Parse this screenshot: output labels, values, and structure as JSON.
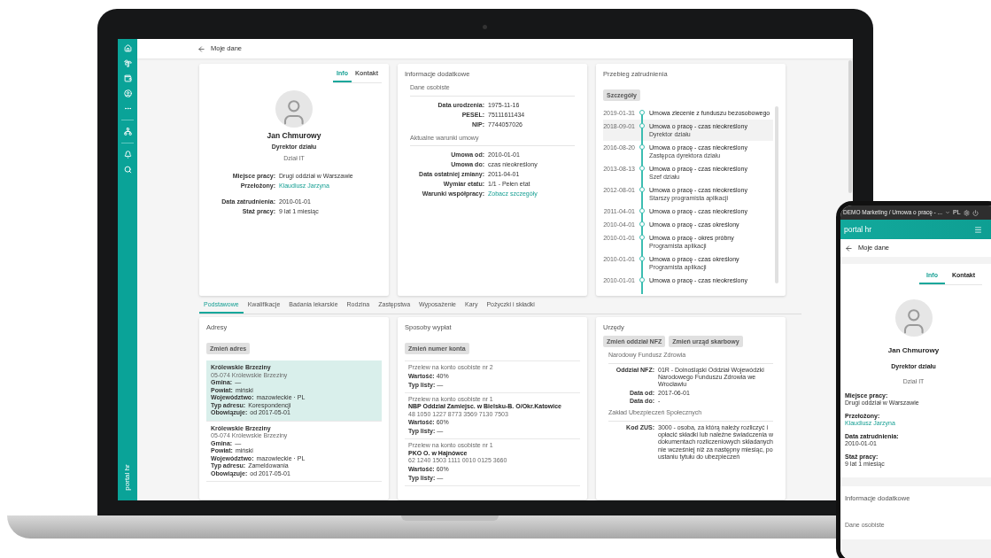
{
  "laptop": {
    "sidebar": {
      "brand": "portal hr"
    },
    "header": {
      "title": "Moje dane"
    },
    "profile_card": {
      "tabs": [
        {
          "label": "Info",
          "selected": true
        },
        {
          "label": "Kontakt",
          "selected": false
        }
      ],
      "name": "Jan Chmurowy",
      "position": "Dyrektor działu",
      "department": "Dział IT",
      "field_groups": [
        [
          {
            "label": "Miejsce pracy:",
            "value": "Drugi oddział w Warszawie",
            "kind": "text"
          },
          {
            "label": "Przełożony:",
            "value": "Klaudiusz Jarzyna",
            "kind": "link"
          }
        ],
        [
          {
            "label": "Data zatrudnienia:",
            "value": "2010-01-01",
            "kind": "text"
          },
          {
            "label": "Staż pracy:",
            "value": "9 lat 1 miesiąc",
            "kind": "text"
          }
        ]
      ]
    },
    "additional_info": {
      "title": "Informacje dodatkowe",
      "sections": [
        {
          "heading": "Dane osobiste",
          "fields": [
            {
              "label": "Data urodzenia:",
              "value": "1975-11-16",
              "kind": "text"
            },
            {
              "label": "PESEL:",
              "value": "75111611434",
              "kind": "text"
            },
            {
              "label": "NIP:",
              "value": "7744057026",
              "kind": "text"
            }
          ]
        },
        {
          "heading": "Aktualne warunki umowy",
          "fields": [
            {
              "label": "Umowa od:",
              "value": "2010-01-01",
              "kind": "text"
            },
            {
              "label": "Umowa do:",
              "value": "czas nieokreślony",
              "kind": "text"
            },
            {
              "label": "Data ostatniej zmiany:",
              "value": "2011-04-01",
              "kind": "text"
            },
            {
              "label": "Wymiar etatu:",
              "value": "1/1 - Pełen etat",
              "kind": "text"
            },
            {
              "label": "Warunki współpracy:",
              "value": "Zobacz szczegóły",
              "kind": "link"
            }
          ]
        }
      ]
    },
    "employment_history": {
      "title": "Przebieg zatrudnienia",
      "button": "Szczegóły",
      "entries": [
        {
          "date": "2019-01-31",
          "title": "Umowa zlecenie z funduszu bezosobowego",
          "selected": false
        },
        {
          "date": "2018-09-01",
          "title": "Umowa o pracę - czas nieokreślony",
          "subtitle": "Dyrektor działu",
          "selected": true
        },
        {
          "date": "2016-08-20",
          "title": "Umowa o pracę - czas nieokreślony",
          "subtitle": "Zastępca dyrektora działu",
          "selected": false
        },
        {
          "date": "2013-08-13",
          "title": "Umowa o pracę - czas nieokreślony",
          "subtitle": "Szef działu",
          "selected": false
        },
        {
          "date": "2012-08-01",
          "title": "Umowa o pracę - czas nieokreślony",
          "subtitle": "Starszy programista aplikacji",
          "selected": false
        },
        {
          "date": "2011-04-01",
          "title": "Umowa o pracę - czas nieokreślony",
          "selected": false
        },
        {
          "date": "2010-04-01",
          "title": "Umowa o pracę - czas określony",
          "selected": false
        },
        {
          "date": "2010-01-01",
          "title": "Umowa o pracę - okres próbny",
          "subtitle": "Programista aplikacji",
          "selected": false
        },
        {
          "date": "2010-01-01",
          "title": "Umowa o pracę - czas określony",
          "subtitle": "Programista aplikacji",
          "selected": false
        },
        {
          "date": "2010-01-01",
          "title": "Umowa o pracę - czas nieokreślony",
          "selected": false
        }
      ]
    },
    "tabs": [
      {
        "label": "Podstawowe",
        "selected": true
      },
      {
        "label": "Kwalifikacje",
        "selected": false
      },
      {
        "label": "Badania lekarskie",
        "selected": false
      },
      {
        "label": "Rodzina",
        "selected": false
      },
      {
        "label": "Zastępstwa",
        "selected": false
      },
      {
        "label": "Wyposażenie",
        "selected": false
      },
      {
        "label": "Kary",
        "selected": false
      },
      {
        "label": "Pożyczki i składki",
        "selected": false
      }
    ],
    "addresses": {
      "title": "Adresy",
      "button": "Zmień adres",
      "items": [
        {
          "name": "Królewskie Brzeziny",
          "postal": "05-074 Królewskie Brzeziny",
          "selected": true,
          "fields": [
            {
              "label": "Gmina:",
              "value": "—"
            },
            {
              "label": "Powiat:",
              "value": "miński"
            },
            {
              "label": "Województwo:",
              "value": "mazowieckie · PL"
            },
            {
              "label": "Typ adresu:",
              "value": "Korespondencji"
            },
            {
              "label": "Obowiązuje:",
              "value": "od 2017-05-01"
            }
          ]
        },
        {
          "name": "Królewskie Brzeziny",
          "postal": "05-074 Królewskie Brzeziny",
          "selected": false,
          "fields": [
            {
              "label": "Gmina:",
              "value": "—"
            },
            {
              "label": "Powiat:",
              "value": "miński"
            },
            {
              "label": "Województwo:",
              "value": "mazowieckie · PL"
            },
            {
              "label": "Typ adresu:",
              "value": "Zameldowania"
            },
            {
              "label": "Obowiązuje:",
              "value": "od 2017-05-01"
            }
          ]
        }
      ]
    },
    "payments": {
      "title": "Sposoby wypłat",
      "button": "Zmień numer konta",
      "items": [
        {
          "type": "Przelew na konto osobiste nr 2",
          "details": [
            "**Wartość:** 40%",
            "**Typ listy:** —"
          ]
        },
        {
          "type": "Przelew na konto osobiste nr 1",
          "bank": "NBP Oddział Zamiejsc. w Bielsku-B. O/Okr.Katowice",
          "account": "48 1050 1227 8773 3569 7130 7503",
          "details": [
            "**Wartość:** 60%",
            "**Typ listy:** —"
          ]
        },
        {
          "type": "Przelew na konto osobiste nr 1",
          "bank": "PKO O. w Hajnówce",
          "account": "62 1240 1503 1111 0010 0125 3660",
          "details": [
            "**Wartość:** 60%",
            "**Typ listy:** —"
          ]
        }
      ]
    },
    "offices": {
      "title": "Urzędy",
      "buttons": [
        "Zmień oddział NFZ",
        "Zmień urząd skarbowy"
      ],
      "sections": [
        {
          "heading": "Narodowy Fundusz Zdrowia",
          "fields": [
            {
              "label": "Oddział NFZ:",
              "value": "01R - Dolnośląski Oddział Wojewódzki Narodowego Funduszu Zdrowia we Wrocławiu"
            },
            {
              "label": "Data od:",
              "value": "2017-06-01"
            },
            {
              "label": "Data do:",
              "value": "-"
            }
          ]
        },
        {
          "heading": "Zakład Ubezpieczeń Społecznych",
          "fields": [
            {
              "label": "Kod ZUS:",
              "value": "3000 - osoba, za którą należy rozliczyć i opłacić składki lub należne świadczenia w dokumentach rozliczeniowych składanych nie wcześniej niż za następny miesiąc, po ustaniu tytułu do ubezpieczeń"
            }
          ]
        }
      ]
    }
  },
  "phone": {
    "status_bar": {
      "breadcrumb": "DEMO Marketing / Umowa o pracę - ...",
      "language": "PL"
    },
    "app_bar": {
      "title": "portal hr"
    },
    "header": {
      "title": "Moje dane"
    },
    "tabs": [
      {
        "label": "Info",
        "selected": true
      },
      {
        "label": "Kontakt",
        "selected": false
      }
    ],
    "name": "Jan Chmurowy",
    "position": "Dyrektor działu",
    "department": "Dział IT",
    "fields": [
      {
        "label": "Miejsce pracy:",
        "value": "Drugi oddział w Warszawie",
        "kind": "text"
      },
      {
        "label": "Przełożony:",
        "value": "Klaudiusz Jarzyna",
        "kind": "link"
      },
      {
        "label": "Data zatrudnienia:",
        "value": "2010-01-01",
        "kind": "text"
      },
      {
        "label": "Staż pracy:",
        "value": "9 lat 1 miesiąc",
        "kind": "text"
      }
    ],
    "section": {
      "title": "Informacje dodatkowe",
      "subheading": "Dane osobiste"
    }
  }
}
